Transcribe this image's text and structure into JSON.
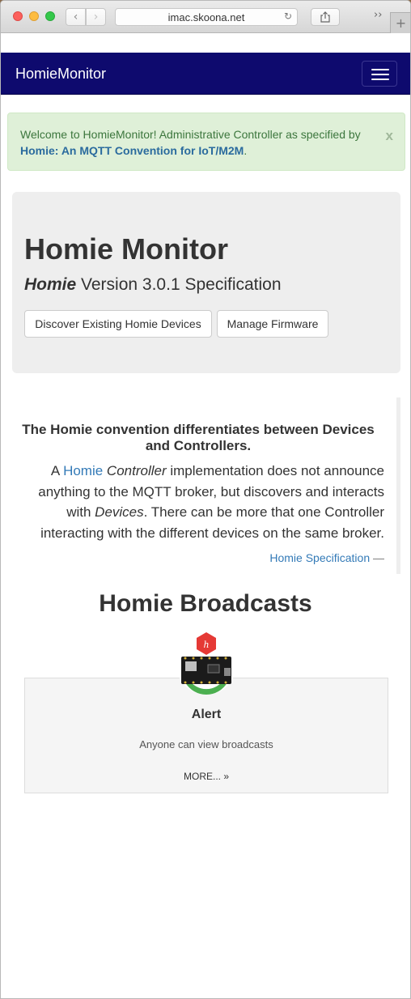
{
  "browser": {
    "address": "imac.skoona.net"
  },
  "navbar": {
    "brand": "HomieMonitor"
  },
  "alert": {
    "text": "Welcome to HomieMonitor! Administrative Controller as specified by",
    "link": "Homie: An MQTT Convention for IoT/M2M",
    "suffix": ".",
    "close": "x"
  },
  "jumbotron": {
    "title": "Homie Monitor",
    "subtitle_bold": "Homie",
    "subtitle_rest": "Version 3.0.1 Specification",
    "buttons": {
      "discover": "Discover Existing Homie Devices",
      "firmware": "Manage Firmware"
    }
  },
  "quote": {
    "heading": "The Homie convention differentiates between Devices and Controllers.",
    "body_prefix": "A",
    "body_link": "Homie",
    "body_em1": "Controller",
    "body_mid": "implementation does not announce anything to the MQTT broker, but discovers and interacts with",
    "body_em2": "Devices",
    "body_end": ". There can be more that one Controller interacting with the different devices on the same broker.",
    "footer_link": "Homie Specification",
    "footer_dash": "—"
  },
  "broadcasts": {
    "title": "Homie Broadcasts",
    "card": {
      "title": "Alert",
      "text": "Anyone can view broadcasts",
      "more": "MORE... »"
    }
  }
}
